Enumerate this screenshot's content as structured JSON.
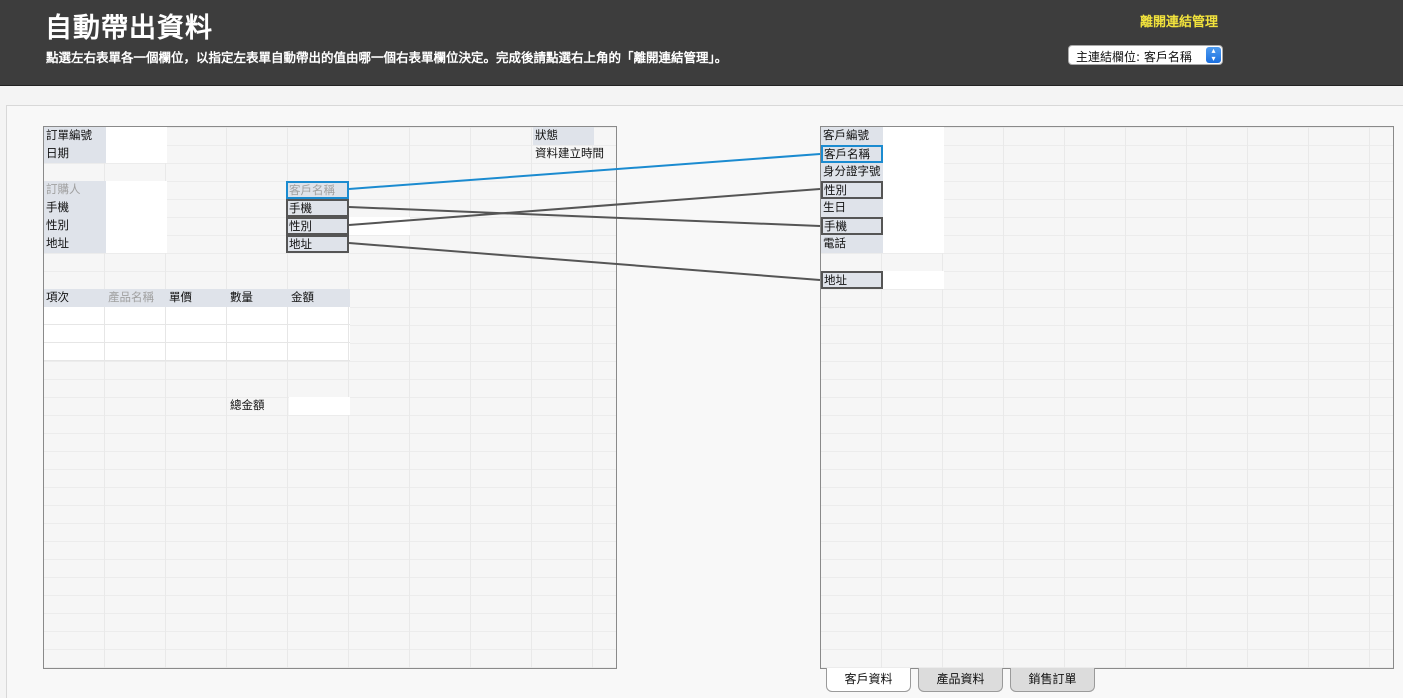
{
  "header": {
    "title": "自動帶出資料",
    "subtitle": "點選左右表單各一個欄位，以指定左表單自動帶出的值由哪一個右表單欄位決定。完成後請點選右上角的「離開連結管理」。",
    "exit_link": "離開連結管理",
    "primary_link_select": "主連結欄位: 客戶名稱"
  },
  "left_form": {
    "order_no_label": "訂單編號",
    "date_label": "日期",
    "status_label": "狀態",
    "created_time_label": "資料建立時間",
    "buyer_label": "訂購人",
    "mobile_label": "手機",
    "gender_label": "性別",
    "address_label": "地址",
    "customer_name_link": "客戶名稱",
    "mobile_link": "手機",
    "gender_link": "性別",
    "address_link": "地址",
    "col_item": "項次",
    "col_product_name": "產品名稱",
    "col_unit_price": "單價",
    "col_quantity": "數量",
    "col_amount": "金額",
    "total_label": "總金額"
  },
  "right_form": {
    "customer_no_label": "客戶編號",
    "customer_name_label": "客戶名稱",
    "id_no_label": "身分證字號",
    "gender_label": "性別",
    "birthday_label": "生日",
    "mobile_label": "手機",
    "phone_label": "電話",
    "address_label": "地址"
  },
  "links": [
    {
      "from": "客戶名稱",
      "to": "客戶名稱",
      "primary": true
    },
    {
      "from": "手機",
      "to": "手機",
      "primary": false
    },
    {
      "from": "性別",
      "to": "性別",
      "primary": false
    },
    {
      "from": "地址",
      "to": "地址",
      "primary": false
    }
  ],
  "tabs": [
    {
      "label": "客戶資料",
      "active": true
    },
    {
      "label": "產品資料",
      "active": false
    },
    {
      "label": "銷售訂單",
      "active": false
    }
  ],
  "colors": {
    "header_bg": "#3d3d3d",
    "exit_link": "#f2e33c",
    "primary_link": "#1b8bd0",
    "secondary_link": "#555555",
    "label_bg": "#dfe3ea"
  }
}
